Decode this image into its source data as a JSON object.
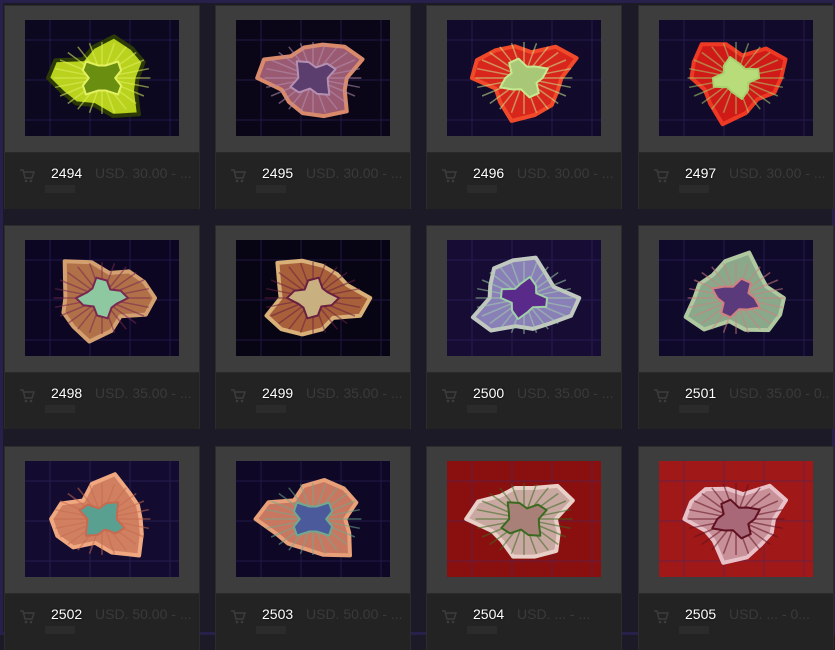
{
  "items": [
    {
      "code": "2494",
      "price": "USD. 30.00 - ...",
      "palette": {
        "bg": "#0b0820",
        "main": "#b8d21e",
        "edge": "#2b3a06",
        "center": "#6a8f10",
        "accent": "#e3f060"
      }
    },
    {
      "code": "2495",
      "price": "USD. 30.00 - ...",
      "palette": {
        "bg": "#0a0618",
        "main": "#9a5a72",
        "edge": "#d98a6a",
        "center": "#5b3d6e",
        "accent": "#b48fb0"
      }
    },
    {
      "code": "2496",
      "price": "USD. 30.00 - ...",
      "palette": {
        "bg": "#120a2a",
        "main": "#d8261c",
        "edge": "#f04a2a",
        "center": "#a8c878",
        "accent": "#c8e890"
      }
    },
    {
      "code": "2497",
      "price": "USD. 30.00 - ...",
      "palette": {
        "bg": "#120a2a",
        "main": "#d01a18",
        "edge": "#ee3a24",
        "center": "#b8dc7a",
        "accent": "#a8d06c"
      }
    },
    {
      "code": "2498",
      "price": "USD. 35.00 - ...",
      "palette": {
        "bg": "#0c0622",
        "main": "#b07048",
        "edge": "#d4a070",
        "center": "#8ec8a0",
        "accent": "#7a2850"
      }
    },
    {
      "code": "2499",
      "price": "USD. 35.00 - ...",
      "palette": {
        "bg": "#070414",
        "main": "#a8603a",
        "edge": "#d8b078",
        "center": "#c8b080",
        "accent": "#6a2040"
      }
    },
    {
      "code": "2500",
      "price": "USD. 35.00 - ...",
      "palette": {
        "bg": "#160c34",
        "main": "#8a80b8",
        "edge": "#c0c8c0",
        "center": "#5a2a8a",
        "accent": "#a0d0a8"
      }
    },
    {
      "code": "2501",
      "price": "USD. 35.00 - 0...",
      "palette": {
        "bg": "#100a2a",
        "main": "#8aa88a",
        "edge": "#b0c8a0",
        "center": "#5a3a7a",
        "accent": "#d08080"
      }
    },
    {
      "code": "2502",
      "price": "USD. 50.00 - ...",
      "palette": {
        "bg": "#140c30",
        "main": "#d08060",
        "edge": "#f0a880",
        "center": "#5aa090",
        "accent": "#c86a50"
      }
    },
    {
      "code": "2503",
      "price": "USD. 50.00 - ...",
      "palette": {
        "bg": "#0e0826",
        "main": "#c87860",
        "edge": "#e8a078",
        "center": "#4a5a9a",
        "accent": "#70a890"
      }
    },
    {
      "code": "2504",
      "price": "USD. ... - ...",
      "palette": {
        "bg": "#8a1010",
        "main": "#c8a8a0",
        "edge": "#e8d0c8",
        "center": "#a88078",
        "accent": "#3a6a20"
      }
    },
    {
      "code": "2505",
      "price": "USD. ... - 0...",
      "palette": {
        "bg": "#a01818",
        "main": "#c89098",
        "edge": "#e8c0c8",
        "center": "#a86878",
        "accent": "#601020"
      }
    }
  ]
}
